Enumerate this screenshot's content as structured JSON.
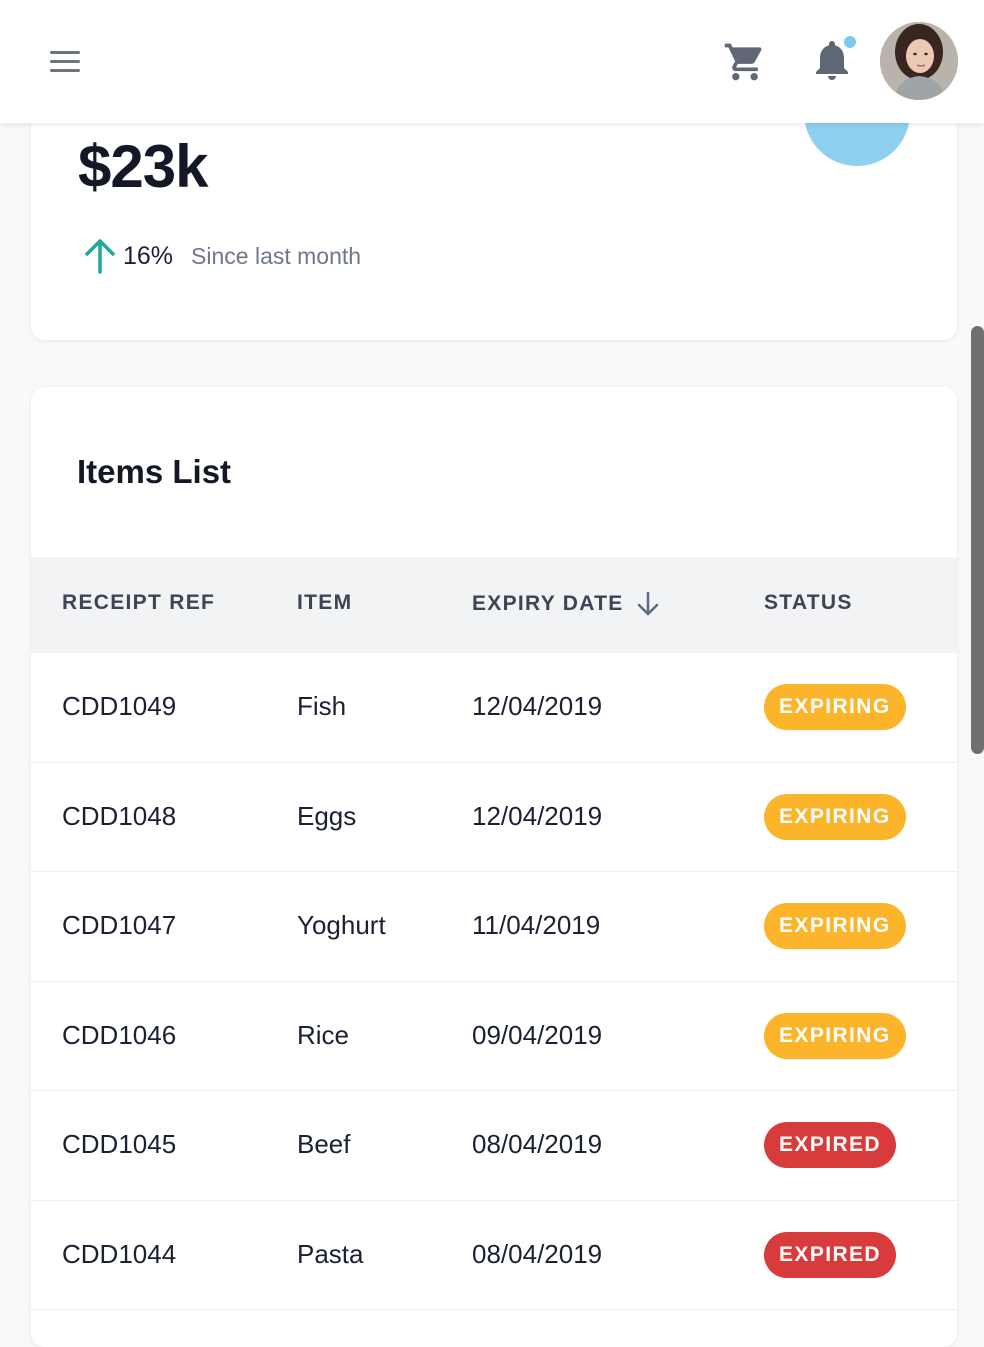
{
  "header": {
    "menu_icon": "hamburger-menu-icon",
    "cart_icon": "shopping-cart-icon",
    "bell_icon": "notification-bell-icon",
    "notification_dot_color": "#7ec8ef"
  },
  "stats": {
    "value": "$23k",
    "trend_percent": "16%",
    "trend_label": "Since last month",
    "trend_direction": "up",
    "trend_color": "#1fa89b",
    "icon_bg_color": "#8fd0f1"
  },
  "items": {
    "title": "Items List",
    "columns": {
      "receipt_ref": "RECEIPT REF",
      "item": "ITEM",
      "expiry_date": "EXPIRY DATE",
      "status": "STATUS"
    },
    "sort": {
      "column": "expiry_date",
      "direction": "descending",
      "icon": "arrow-down-icon"
    },
    "rows": [
      {
        "ref": "CDD1049",
        "item": "Fish",
        "date": "12/04/2019",
        "status": "EXPIRING"
      },
      {
        "ref": "CDD1048",
        "item": "Eggs",
        "date": "12/04/2019",
        "status": "EXPIRING"
      },
      {
        "ref": "CDD1047",
        "item": "Yoghurt",
        "date": "11/04/2019",
        "status": "EXPIRING"
      },
      {
        "ref": "CDD1046",
        "item": "Rice",
        "date": "09/04/2019",
        "status": "EXPIRING"
      },
      {
        "ref": "CDD1045",
        "item": "Beef",
        "date": "08/04/2019",
        "status": "EXPIRED"
      },
      {
        "ref": "CDD1044",
        "item": "Pasta",
        "date": "08/04/2019",
        "status": "EXPIRED"
      }
    ],
    "status_colors": {
      "EXPIRING": "#fcb42a",
      "EXPIRED": "#d83b3b"
    }
  }
}
